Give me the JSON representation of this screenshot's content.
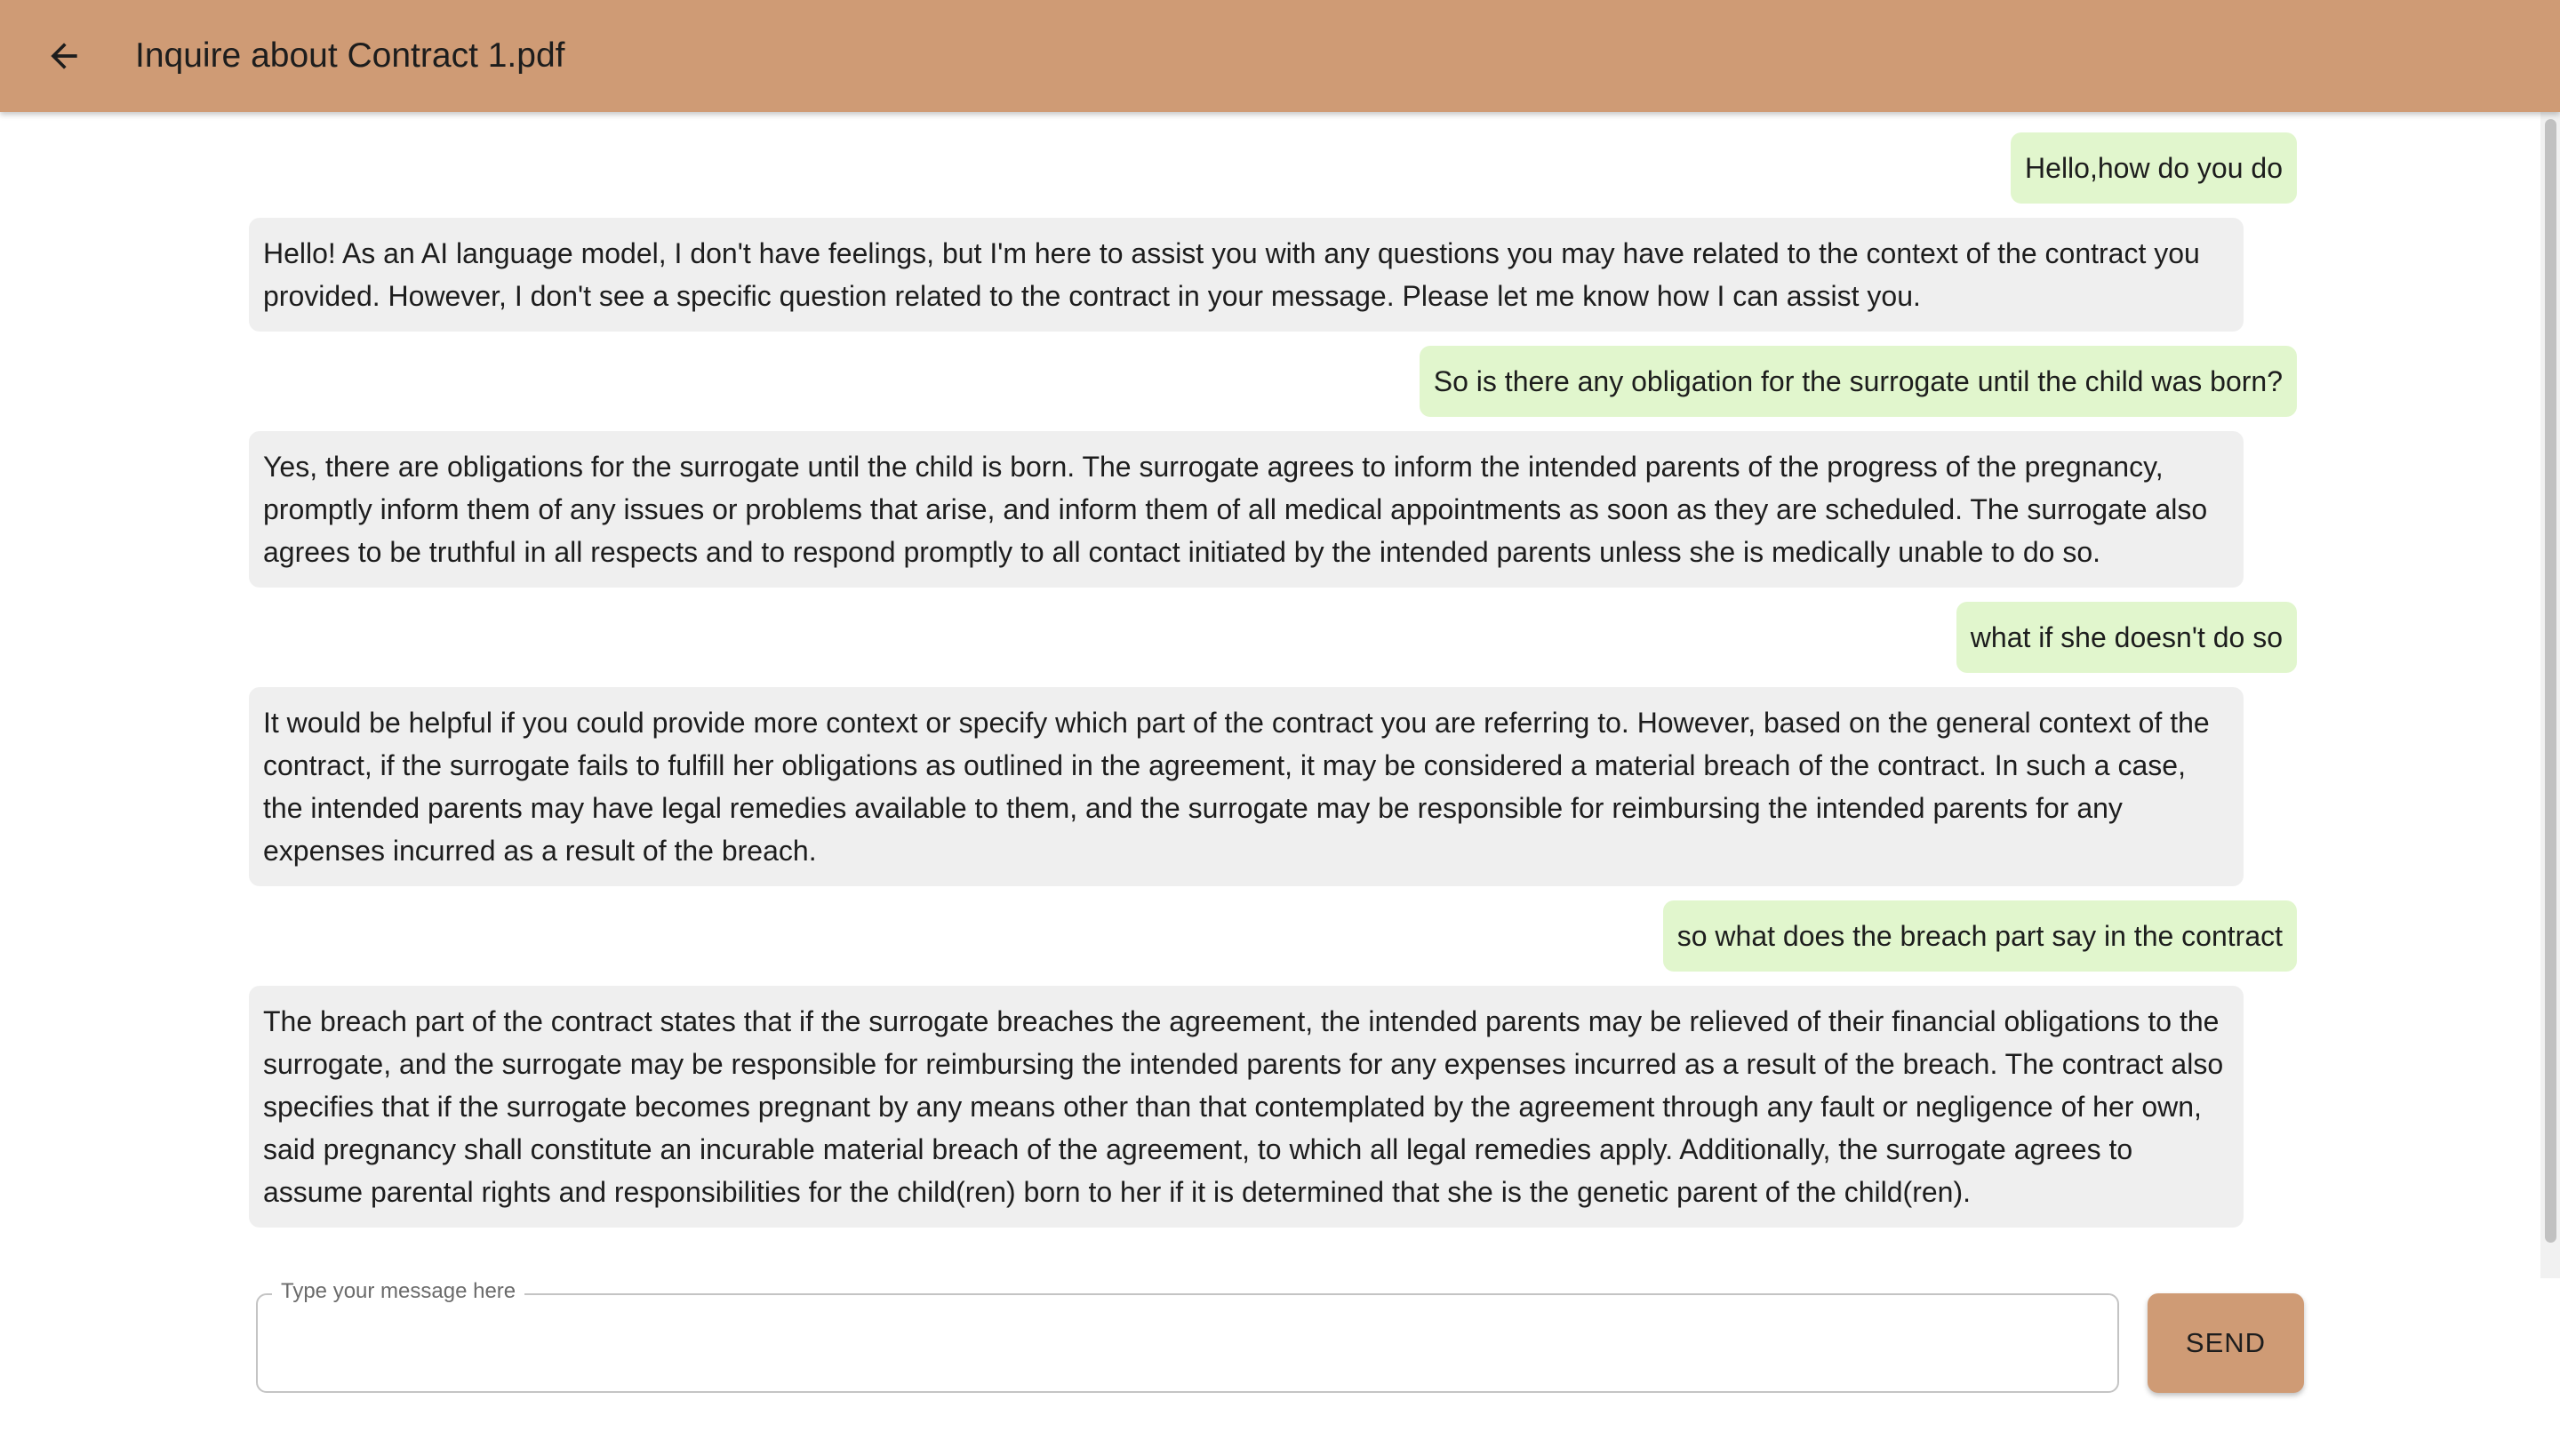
{
  "header": {
    "back_icon": "arrow-left-icon",
    "title": "Inquire about Contract 1.pdf",
    "background_color": "#cf9b75"
  },
  "messages": [
    {
      "role": "user",
      "text": "Hello,how do you do"
    },
    {
      "role": "assistant",
      "text": "Hello! As an AI language model, I don't have feelings, but I'm here to assist you with any questions you may have related to the context of the contract you provided. However, I don't see a specific question related to the contract in your message. Please let me know how I can assist you."
    },
    {
      "role": "user",
      "text": "So is there any obligation for the surrogate until the child was born?"
    },
    {
      "role": "assistant",
      "text": "Yes, there are obligations for the surrogate until the child is born. The surrogate agrees to inform the intended parents of the progress of the pregnancy, promptly inform them of any issues or problems that arise, and inform them of all medical appointments as soon as they are scheduled. The surrogate also agrees to be truthful in all respects and to respond promptly to all contact initiated by the intended parents unless she is medically unable to do so."
    },
    {
      "role": "user",
      "text": "what if she doesn't do so"
    },
    {
      "role": "assistant",
      "text": "It would be helpful if you could provide more context or specify which part of the contract you are referring to. However, based on the general context of the contract, if the surrogate fails to fulfill her obligations as outlined in the agreement, it may be considered a material breach of the contract. In such a case, the intended parents may have legal remedies available to them, and the surrogate may be responsible for reimbursing the intended parents for any expenses incurred as a result of the breach."
    },
    {
      "role": "user",
      "text": "so what does the breach part say in the contract"
    },
    {
      "role": "assistant",
      "text": "The breach part of the contract states that if the surrogate breaches the agreement, the intended parents may be relieved of their financial obligations to the surrogate, and the surrogate may be responsible for reimbursing the intended parents for any expenses incurred as a result of the breach. The contract also specifies that if the surrogate becomes pregnant by any means other than that contemplated by the agreement through any fault or negligence of her own, said pregnancy shall constitute an incurable material breach of the agreement, to which all legal remedies apply. Additionally, the surrogate agrees to assume parental rights and responsibilities for the child(ren) born to her if it is determined that she is the genetic parent of the child(ren)."
    }
  ],
  "composer": {
    "label": "Type your message here",
    "value": "",
    "send_label": "SEND"
  },
  "colors": {
    "user_bubble": "#e1f6cd",
    "assistant_bubble": "#efefef",
    "accent": "#cf9b75"
  }
}
